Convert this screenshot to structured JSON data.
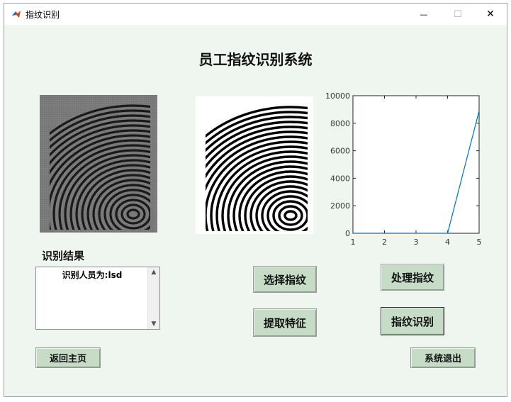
{
  "window": {
    "title": "指纹识别",
    "buttons": {
      "minimize": "—",
      "maximize": "☐",
      "close": "✕"
    }
  },
  "heading": "员工指纹识别系统",
  "result": {
    "label": "识别结果",
    "items": [
      "识别人员为:lsd"
    ]
  },
  "buttons": {
    "select_fingerprint": "选择指纹",
    "process_fingerprint": "处理指纹",
    "extract_features": "提取特征",
    "identify_fingerprint": "指纹识别",
    "return_home": "返回主页",
    "exit_system": "系统退出"
  },
  "chart_data": {
    "type": "line",
    "x": [
      1,
      2,
      3,
      4,
      5
    ],
    "series": [
      {
        "values": [
          0,
          0,
          0,
          0,
          8900
        ]
      }
    ],
    "xlim": [
      1,
      5
    ],
    "ylim": [
      0,
      10000
    ],
    "xticks": [
      "1",
      "2",
      "3",
      "4",
      "5"
    ],
    "yticks": [
      "0",
      "2000",
      "4000",
      "6000",
      "8000",
      "10000"
    ],
    "line_color": "#0072BD",
    "grid": false
  }
}
